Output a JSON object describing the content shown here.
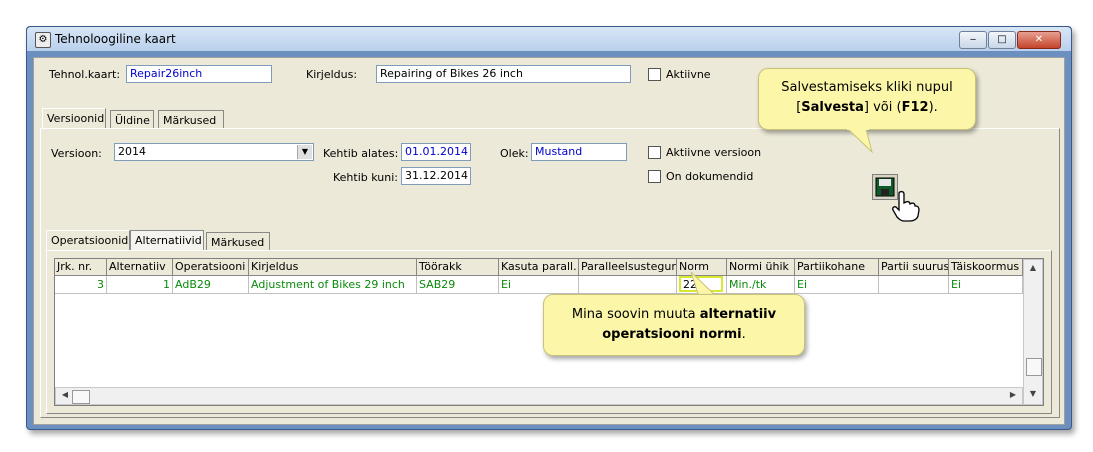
{
  "window": {
    "title": "Tehnoloogiline kaart",
    "buttons": [
      "‒",
      "□",
      "✕"
    ]
  },
  "header": {
    "code_label": "Tehnol.kaart:",
    "code_value": "Repair26inch",
    "desc_label": "Kirjeldus:",
    "desc_value": "Repairing of Bikes 26 inch",
    "active_label": "Aktiivne"
  },
  "tabs_top": [
    "Versioonid",
    "Üldine",
    "Märkused"
  ],
  "version": {
    "version_label": "Versioon:",
    "version_value": "2014",
    "valid_from_label": "Kehtib alates:",
    "valid_from_value": "01.01.2014",
    "valid_to_label": "Kehtib kuni:",
    "valid_to_value": "31.12.2014",
    "status_label": "Olek:",
    "status_value": "Mustand",
    "active_version_label": "Aktiivne versioon",
    "has_docs_label": "On dokumendid"
  },
  "tabs_inner": [
    "Operatsioonid",
    "Alternatiivid",
    "Märkused"
  ],
  "table": {
    "columns": [
      "Jrk. nr.",
      "Alternatiiv",
      "Operatsiooni k",
      "Kirjeldus",
      "Töörakk",
      "Kasuta parall.",
      "Paralleelsustegur",
      "Norm",
      "Normi ühik",
      "Partiikohane",
      "Partii suurus",
      "Täiskoormus"
    ],
    "rows": [
      [
        "3",
        "1",
        "AdB29",
        "Adjustment of Bikes 29 inch",
        "SAB29",
        "Ei",
        "",
        "22",
        "Min./tk",
        "Ei",
        "",
        "Ei"
      ]
    ]
  },
  "callouts": {
    "save_pre": "Salvestamiseks kliki nupul",
    "save_bracket_open": "[",
    "save_bold": "Salvesta",
    "save_mid": "] või (",
    "save_key": "F12",
    "save_end": ").",
    "norm_pre": "Mina soovin muuta ",
    "norm_bold1": "alternatiiv",
    "norm_bold2": "operatsiooni normi",
    "norm_end": "."
  },
  "colors": {
    "accent_green": "#0a8a0a",
    "highlight": "#d8e832",
    "callout_bg": "#fbf6a8"
  },
  "icons": [
    "window-app-icon",
    "save-disk-icon",
    "hand-cursor-icon",
    "dropdown-arrow-icon",
    "scroll-up-icon",
    "scroll-down-icon",
    "scroll-left-icon",
    "scroll-right-icon"
  ]
}
